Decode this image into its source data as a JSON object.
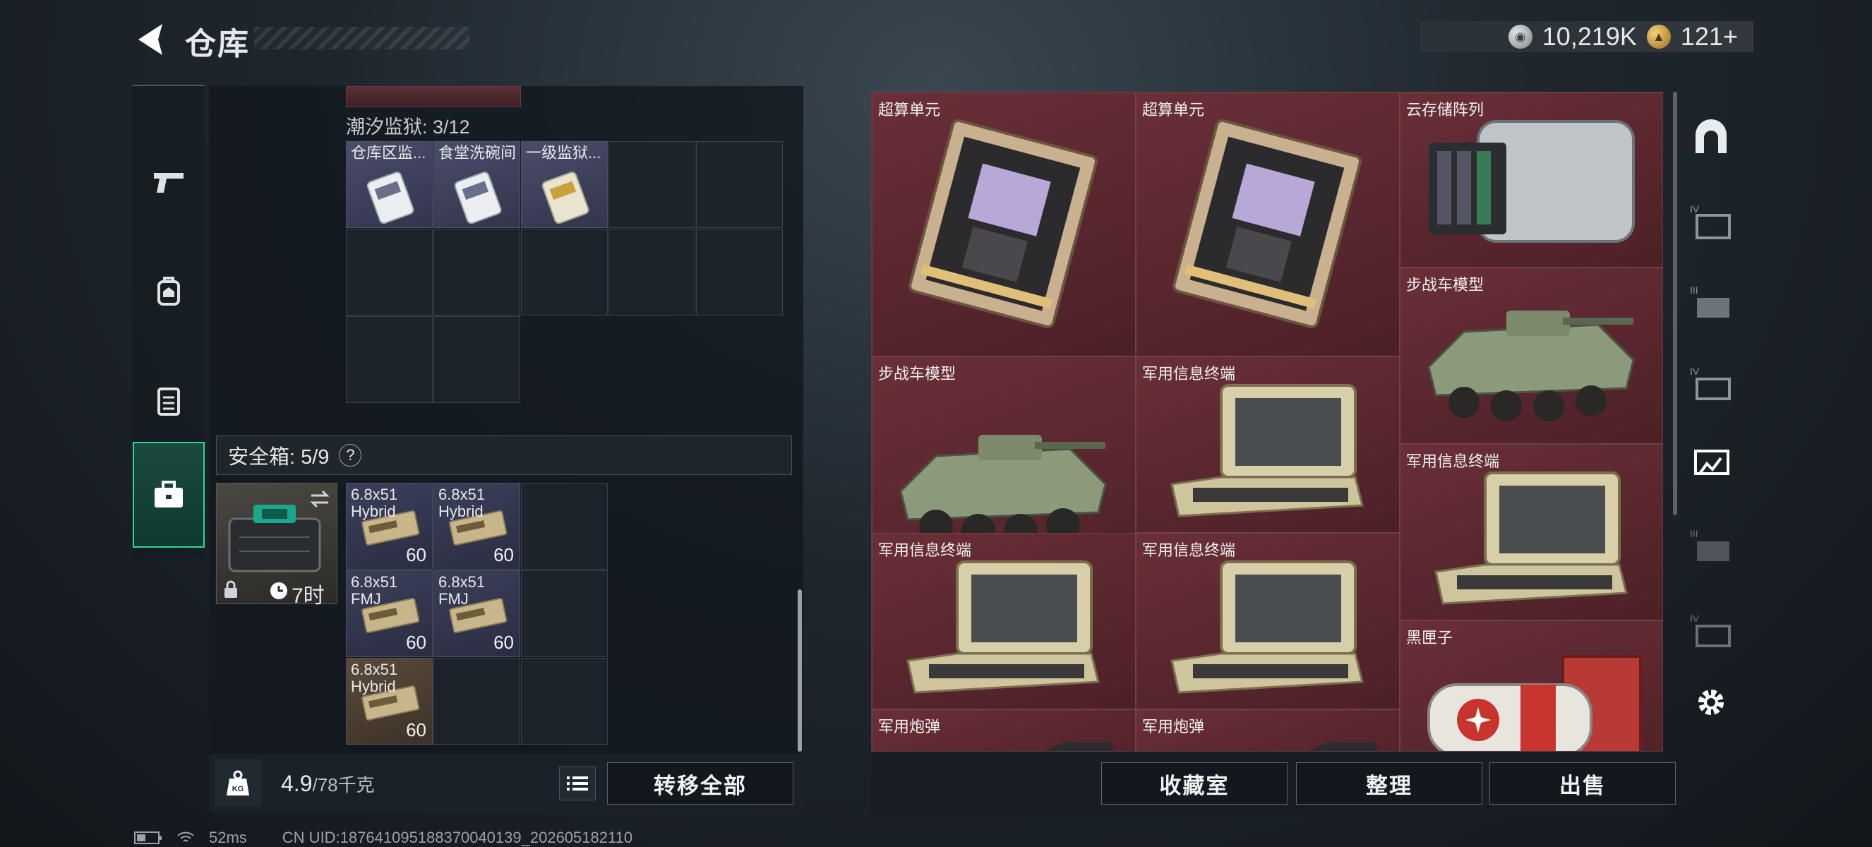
{
  "header": {
    "title": "仓库"
  },
  "currency": {
    "silver": "10,219K",
    "gold": "121+"
  },
  "left_rail": {
    "tabs": [
      {
        "name": "weapon-tab"
      },
      {
        "name": "backpack-tab"
      },
      {
        "name": "vest-tab"
      },
      {
        "name": "case-tab"
      }
    ]
  },
  "prison_container": {
    "title": "潮汐监狱: 3/12",
    "items": [
      {
        "label": "仓库区监..."
      },
      {
        "label": "食堂洗碗间"
      },
      {
        "label": "一级监狱..."
      }
    ]
  },
  "safe_box": {
    "title": "安全箱: 5/9",
    "help": "?",
    "timer": "7时",
    "items": [
      {
        "line1": "6.8x51",
        "line2": "Hybrid",
        "qty": "60"
      },
      {
        "line1": "6.8x51",
        "line2": "Hybrid",
        "qty": "60"
      },
      {
        "line1": "6.8x51",
        "line2": "FMJ",
        "qty": "60"
      },
      {
        "line1": "6.8x51",
        "line2": "FMJ",
        "qty": "60"
      },
      {
        "line1": "6.8x51",
        "line2": "Hybrid",
        "qty": "60"
      }
    ]
  },
  "weight": {
    "current": "4.9",
    "max": "/78千克"
  },
  "buttons": {
    "transfer_all": "转移全部",
    "collection": "收藏室",
    "organize": "整理",
    "sell": "出售"
  },
  "stash": {
    "items": [
      {
        "label": "超算单元",
        "kind": "chip"
      },
      {
        "label": "超算单元",
        "kind": "chip"
      },
      {
        "label": "云存储阵列",
        "kind": "server"
      },
      {
        "label": "步战车模型",
        "kind": "apc"
      },
      {
        "label": "步战车模型",
        "kind": "apc"
      },
      {
        "label": "军用信息终端",
        "kind": "terminal"
      },
      {
        "label": "军用信息终端",
        "kind": "terminal"
      },
      {
        "label": "军用信息终端",
        "kind": "terminal"
      },
      {
        "label": "军用信息终端",
        "kind": "terminal"
      },
      {
        "label": "黑匣子",
        "kind": "blackbox"
      },
      {
        "label": "军用炮弹",
        "kind": "shell"
      },
      {
        "label": "军用炮弹",
        "kind": "shell"
      }
    ]
  },
  "right_rail": {
    "tier_labels": [
      "IV",
      "III",
      "IV",
      "III",
      "IV"
    ]
  },
  "footer": {
    "ping": "52ms",
    "uid": "CN UID:187641095188370040139_202605182110"
  }
}
